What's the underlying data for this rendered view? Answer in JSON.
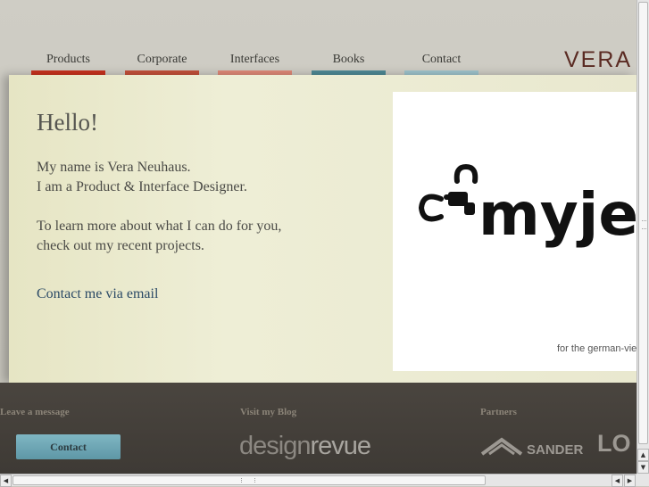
{
  "nav": {
    "items": [
      {
        "label": "Products",
        "color": "#c8321e"
      },
      {
        "label": "Corporate",
        "color": "#c4503a"
      },
      {
        "label": "Interfaces",
        "color": "#e08a78"
      },
      {
        "label": "Books",
        "color": "#4f8a96"
      },
      {
        "label": "Contact",
        "color": "#9fc4cc"
      }
    ]
  },
  "logo": {
    "text": "VERA"
  },
  "main": {
    "heading": "Hello!",
    "intro_line1": "My name is Vera Neuhaus.",
    "intro_line2": "I am a Product & Interface Designer.",
    "intro_line3": "To learn more about what I can do for you,",
    "intro_line4": "check out my recent projects.",
    "email_link": "Contact me via email"
  },
  "showcase": {
    "logo_text": "myje",
    "caption": "for the german-vie"
  },
  "footer": {
    "message_heading": "Leave a message",
    "contact_button": "Contact",
    "blog_heading": "Visit my Blog",
    "blog_logo_bold": "design",
    "blog_logo_thin": "revue",
    "partners_heading": "Partners",
    "partner1": "SANDER",
    "partner2": "LO"
  }
}
